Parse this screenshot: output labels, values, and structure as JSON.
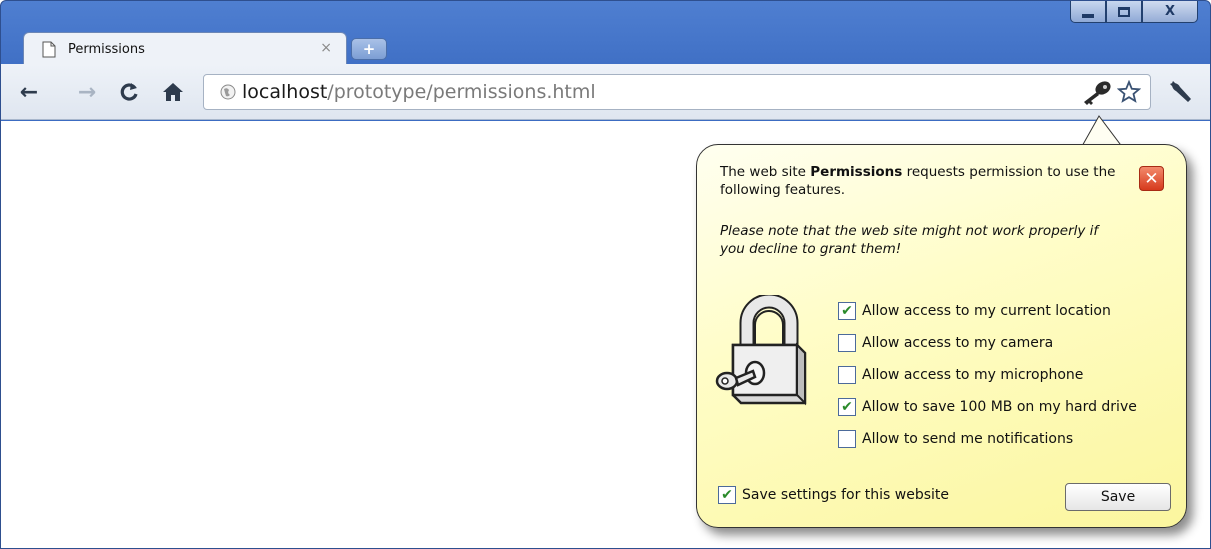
{
  "window": {
    "controls": {
      "minimize": "minimize",
      "maximize": "maximize",
      "close": "X"
    }
  },
  "tab": {
    "title": "Permissions",
    "close_glyph": "×",
    "new_tab_glyph": "+"
  },
  "toolbar": {
    "url_host": "localhost",
    "url_path": "/prototype/permissions.html"
  },
  "popup": {
    "message_prefix": "The web site ",
    "message_site": "Permissions",
    "message_suffix": " requests permission to use the following features.",
    "warning": "Please note that the web site might not work properly if you decline to grant them!",
    "permissions": [
      {
        "label": "Allow access to my current location",
        "checked": true
      },
      {
        "label": "Allow access to my camera",
        "checked": false
      },
      {
        "label": "Allow access to my microphone",
        "checked": false
      },
      {
        "label": "Allow to save 100 MB on my hard drive",
        "checked": true
      },
      {
        "label": "Allow to send me notifications",
        "checked": false
      }
    ],
    "save_settings_label": "Save settings for this website",
    "save_settings_checked": true,
    "save_button": "Save"
  },
  "colors": {
    "frame": "#4f7fd1",
    "popup_bg": "#fffdc8",
    "close_button": "#d63a1d",
    "check": "#2a8a2a"
  }
}
